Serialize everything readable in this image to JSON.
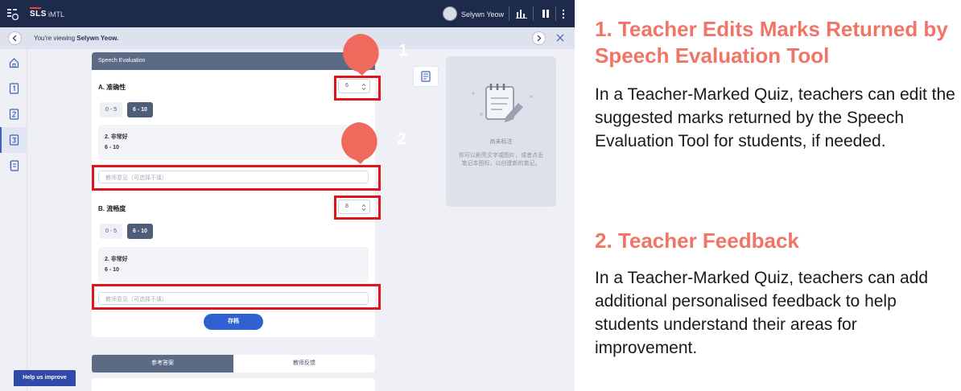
{
  "topbar": {
    "brand": "SLS",
    "app_name": "iMTL",
    "user_name": "Selywn Yeow",
    "icons": [
      "apps-grid-icon",
      "avatar",
      "bar-chart-icon",
      "pause-icon",
      "more-vertical-icon"
    ]
  },
  "viewbar": {
    "prefix": "You're viewing ",
    "name": "Selywn Yeow."
  },
  "sidebar": {
    "icons": [
      "home-icon",
      "page-1-icon",
      "page-2-icon",
      "page-3-icon",
      "notes-icon"
    ],
    "help_label": "Help us improve"
  },
  "panel": {
    "header": "Speech Evaluation",
    "criteria": [
      {
        "title": "A. 准确性",
        "mark": "6",
        "ranges": [
          "0 - 5",
          "6 - 10"
        ],
        "selected_range": "6 - 10",
        "band_title": "2. 非常好",
        "band_range": "6 - 10",
        "feedback_placeholder": "教师意见（可选择不填）"
      },
      {
        "title": "B. 流畅度",
        "mark": "8",
        "ranges": [
          "0 - 5",
          "6 - 10"
        ],
        "selected_range": "6 - 10",
        "band_title": "2. 非常好",
        "band_range": "6 - 10",
        "feedback_placeholder": "教师意见（可选择不填）"
      }
    ],
    "save_label": "存档"
  },
  "tabs": [
    "参考答案",
    "教师反馈"
  ],
  "callouts": [
    "1",
    "2"
  ],
  "notes": {
    "title": "尚未标注",
    "hint": "你可以刷亮文字或图片，或者点击笔记本图标，以创建新的笔记。"
  },
  "explanation": {
    "section1_title": "1. Teacher Edits Marks Returned by Speech Evaluation Tool",
    "section1_body": "In a Teacher-Marked Quiz, teachers can edit the suggested marks returned by the Speech Evaluation Tool for students, if needed.",
    "section2_title": "2. Teacher Feedback",
    "section2_body": "In a Teacher-Marked Quiz, teachers can add additional personalised feedback to help students understand their areas for improvement."
  },
  "colors": {
    "topbar": "#1e2a4a",
    "highlight": "#e0141b",
    "bubble": "#ef6a5c",
    "heading": "#f07566",
    "save_button": "#2f62d0"
  }
}
